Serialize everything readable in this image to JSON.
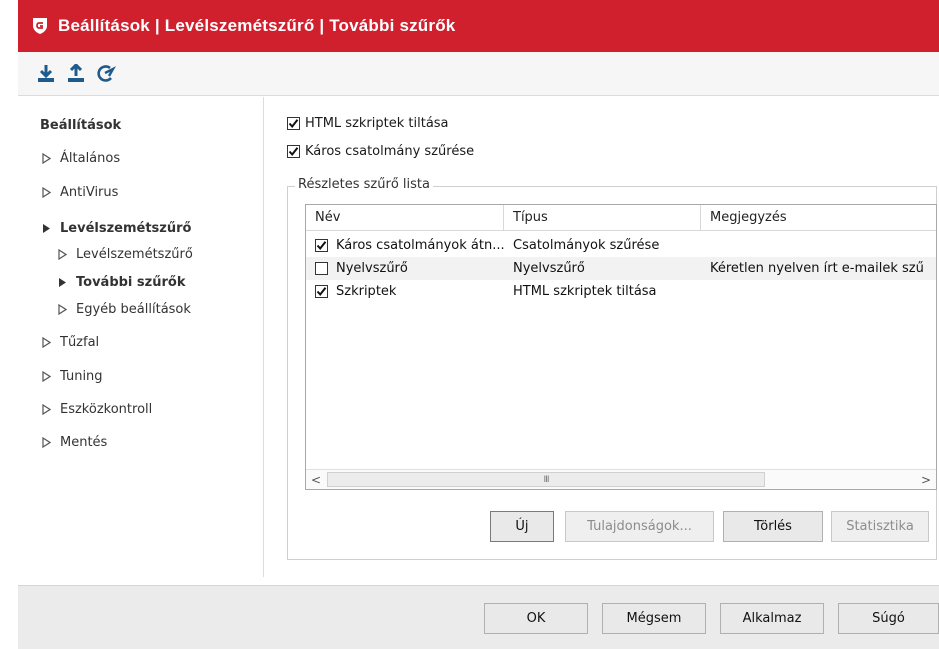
{
  "window": {
    "title": "Beállítások | Levélszemétszűrő | További szűrők",
    "brand_color": "#d0202e"
  },
  "toolbar": {
    "items": [
      {
        "icon": "import-icon"
      },
      {
        "icon": "export-icon"
      },
      {
        "icon": "reset-icon"
      }
    ]
  },
  "sidebar": {
    "header": "Beállítások",
    "items": [
      {
        "label": "Általános"
      },
      {
        "label": "AntiVirus"
      },
      {
        "label": "Levélszemétszűrő"
      },
      {
        "label": "Levélszemétszűrő"
      },
      {
        "label": "További szűrők"
      },
      {
        "label": "Egyéb beállítások"
      },
      {
        "label": "Tűzfal"
      },
      {
        "label": "Tuning"
      },
      {
        "label": "Eszközkontroll"
      },
      {
        "label": "Mentés"
      }
    ]
  },
  "options": {
    "html_scripts": {
      "label": "HTML szkriptek tiltása",
      "checked": true
    },
    "attachment_filter": {
      "label": "Káros csatolmány szűrése",
      "checked": true
    }
  },
  "filter_list": {
    "group_label": "Részletes szűrő lista",
    "columns": [
      "Név",
      "Típus",
      "Megjegyzés"
    ],
    "rows": [
      {
        "checked": true,
        "name": "Káros csatolmányok átn...",
        "type": "Csatolmányok szűrése",
        "note": ""
      },
      {
        "checked": false,
        "name": "Nyelvszűrő",
        "type": "Nyelvszűrő",
        "note": "Kéretlen nyelven írt e-mailek szű"
      },
      {
        "checked": true,
        "name": "Szkriptek",
        "type": "HTML szkriptek tiltása",
        "note": ""
      }
    ],
    "scroll_left": "<",
    "scroll_right": ">",
    "scroll_grip": "III"
  },
  "list_buttons": {
    "new": "Új",
    "properties": "Tulajdonságok...",
    "delete": "Törlés",
    "statistics": "Statisztika"
  },
  "footer": {
    "ok": "OK",
    "cancel": "Mégsem",
    "apply": "Alkalmaz",
    "help": "Súgó"
  }
}
